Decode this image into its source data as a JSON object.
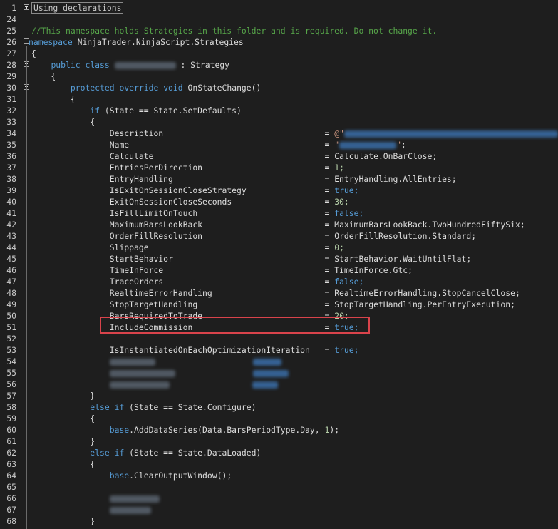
{
  "collapsed_region_label": "Using declarations",
  "comment_line": "//This namespace holds Strategies in this folder and is required. Do not change it.",
  "namespace_kw": "namespace",
  "namespace_name": " NinjaTrader.NinjaScript.Strategies",
  "class_decl": {
    "kw1": "public",
    "kw2": "class",
    "base": " : Strategy"
  },
  "method_decl": {
    "kw1": "protected",
    "kw2": "override",
    "kw3": "void",
    "name": " OnStateChange()"
  },
  "if_setdefaults": {
    "kw": "if",
    "rest": " (State == State.SetDefaults)"
  },
  "settings": [
    {
      "line": "34",
      "name": "Description",
      "value": "@\"",
      "blurred": true
    },
    {
      "line": "35",
      "name": "Name",
      "value": "\"",
      "blurred": true
    },
    {
      "line": "36",
      "name": "Calculate",
      "value": "Calculate.OnBarClose;"
    },
    {
      "line": "37",
      "name": "EntriesPerDirection",
      "value": "1;"
    },
    {
      "line": "38",
      "name": "EntryHandling",
      "value": "EntryHandling.AllEntries;"
    },
    {
      "line": "39",
      "name": "IsExitOnSessionCloseStrategy",
      "value": "true;"
    },
    {
      "line": "40",
      "name": "ExitOnSessionCloseSeconds",
      "value": "30;"
    },
    {
      "line": "41",
      "name": "IsFillLimitOnTouch",
      "value": "false;"
    },
    {
      "line": "42",
      "name": "MaximumBarsLookBack",
      "value": "MaximumBarsLookBack.TwoHundredFiftySix;"
    },
    {
      "line": "43",
      "name": "OrderFillResolution",
      "value": "OrderFillResolution.Standard;"
    },
    {
      "line": "44",
      "name": "Slippage",
      "value": "0;"
    },
    {
      "line": "45",
      "name": "StartBehavior",
      "value": "StartBehavior.WaitUntilFlat;"
    },
    {
      "line": "46",
      "name": "TimeInForce",
      "value": "TimeInForce.Gtc;"
    },
    {
      "line": "47",
      "name": "TraceOrders",
      "value": "false;"
    },
    {
      "line": "48",
      "name": "RealtimeErrorHandling",
      "value": "RealtimeErrorHandling.StopCancelClose;"
    },
    {
      "line": "49",
      "name": "StopTargetHandling",
      "value": "StopTargetHandling.PerEntryExecution;"
    },
    {
      "line": "50",
      "name": "BarsRequiredToTrade",
      "value": "20;"
    },
    {
      "line": "51",
      "name": "IncludeCommission",
      "value": "true;"
    }
  ],
  "line53": {
    "name": "IsInstantiatedOnEachOptimizationIteration",
    "value": "true;"
  },
  "else_if_configure": {
    "kw1": "else",
    "kw2": "if",
    "rest": " (State == State.Configure)"
  },
  "add_data_series": {
    "kw": "base",
    "rest": ".AddDataSeries(Data.BarsPeriodType.Day, ",
    "num": "1",
    "end": ");"
  },
  "else_if_dataloaded": {
    "kw1": "else",
    "kw2": "if",
    "rest": " (State == State.DataLoaded)"
  },
  "clear_output": {
    "kw": "base",
    "rest": ".ClearOutputWindow();"
  },
  "line_numbers": [
    "1",
    "24",
    "25",
    "26",
    "27",
    "28",
    "29",
    "30",
    "31",
    "32",
    "33",
    "34",
    "35",
    "36",
    "37",
    "38",
    "39",
    "40",
    "41",
    "42",
    "43",
    "44",
    "45",
    "46",
    "47",
    "48",
    "49",
    "50",
    "51",
    "52",
    "53",
    "54",
    "55",
    "56",
    "57",
    "58",
    "59",
    "60",
    "61",
    "62",
    "63",
    "64",
    "65",
    "66",
    "67",
    "68"
  ],
  "colors": {
    "background": "#1e1e1e",
    "keyword": "#569cd6",
    "comment": "#57a64a",
    "number": "#b5cea8",
    "string": "#d69d85",
    "highlight_border": "#d9434b"
  }
}
